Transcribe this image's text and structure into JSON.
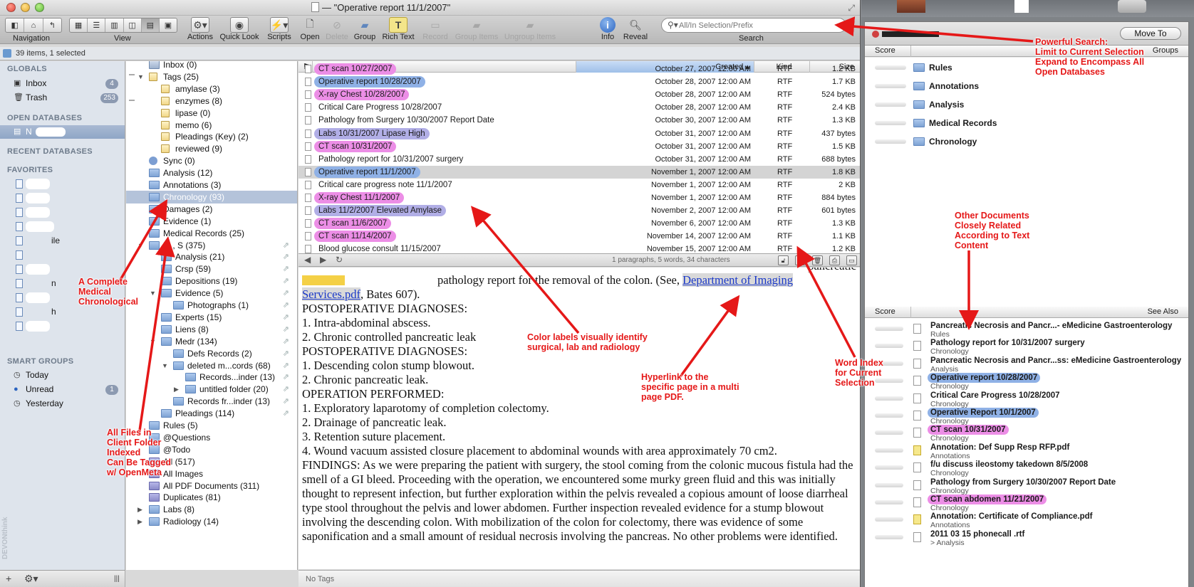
{
  "window": {
    "title": "— \"Operative report 11/1/2007\""
  },
  "toolbar": {
    "groups": {
      "navigation": "Navigation",
      "view": "View",
      "search": "Search"
    },
    "buttons": {
      "actions": "Actions",
      "quick_look": "Quick Look",
      "scripts": "Scripts",
      "open": "Open",
      "delete": "Delete",
      "group": "Group",
      "rich_text": "Rich Text",
      "record": "Record",
      "group_items": "Group Items",
      "ungroup_items": "Ungroup Items",
      "info": "Info",
      "reveal": "Reveal"
    },
    "search_placeholder": "All/In Selection/Prefix"
  },
  "status": {
    "text": "39 items, 1 selected"
  },
  "sidebar": {
    "globals_header": "GLOBALS",
    "inbox": {
      "label": "Inbox",
      "count": "4"
    },
    "trash": {
      "label": "Trash",
      "count": "253"
    },
    "open_db_header": "OPEN DATABASES",
    "open_db_item": "N",
    "recent_header": "RECENT DATABASES",
    "favorites_header": "FAVORITES",
    "favorites_text": [
      "ile",
      "n",
      "h"
    ],
    "smart_header": "SMART GROUPS",
    "today": "Today",
    "unread": {
      "label": "Unread",
      "count": "1"
    },
    "yesterday": "Yesterday",
    "vertical_brand": "DEVONthink"
  },
  "groups": [
    "Inbox (0)",
    "Tags (25)",
    "amylase (3)",
    "enzymes (8)",
    "lipase (0)",
    "memo (6)",
    "Pleadings (Key) (2)",
    "reviewed (9)",
    "Sync (0)",
    "Analysis (12)",
    "Annotations (3)",
    "Chronology (93)",
    "Damages (2)",
    "Evidence (1)",
    "Medical Records (25)",
    "M , S (375)",
    "Analysis (21)",
    "Crsp (59)",
    "Depositions (19)",
    "Evidence (5)",
    "Photographs (1)",
    "Experts (15)",
    "Liens (8)",
    "Medr (134)",
    "Defs Records (2)",
    "deleted m...cords (68)",
    "Records...inder (13)",
    "untitled folder (20)",
    "Records fr...inder (13)",
    "Pleadings (114)",
    "Rules (5)",
    "@Questions",
    "@Todo",
    "All (517)",
    "All Images",
    "All PDF Documents (311)",
    "Duplicates (81)",
    "Labs (8)",
    "Radiology (14)"
  ],
  "list": {
    "headers": {
      "name": "Name",
      "created": "Created",
      "kind": "Kind",
      "size": "Size"
    },
    "rows": [
      {
        "name": "CT scan 10/27/2007",
        "created": "October 27, 2007 12:00 AM",
        "kind": "RTF",
        "size": "1.2 KB"
      },
      {
        "name": "Operative report 10/28/2007",
        "created": "October 28, 2007 12:00 AM",
        "kind": "RTF",
        "size": "1.7 KB"
      },
      {
        "name": "X-ray Chest 10/28/2007",
        "created": "October 28, 2007 12:00 AM",
        "kind": "RTF",
        "size": "524 bytes"
      },
      {
        "name": "Critical Care Progress 10/28/2007",
        "created": "October 28, 2007 12:00 AM",
        "kind": "RTF",
        "size": "2.4 KB"
      },
      {
        "name": "Pathology from Surgery 10/30/2007 Report Date",
        "created": "October 30, 2007 12:00 AM",
        "kind": "RTF",
        "size": "1.3 KB"
      },
      {
        "name": "Labs 10/31/2007 Lipase High",
        "created": "October 31, 2007 12:00 AM",
        "kind": "RTF",
        "size": "437 bytes"
      },
      {
        "name": "CT scan 10/31/2007",
        "created": "October 31, 2007 12:00 AM",
        "kind": "RTF",
        "size": "1.5 KB"
      },
      {
        "name": "Pathology report for 10/31/2007 surgery",
        "created": "October 31, 2007 12:00 AM",
        "kind": "RTF",
        "size": "688 bytes"
      },
      {
        "name": "Operative report 11/1/2007",
        "created": "November 1, 2007 12:00 AM",
        "kind": "RTF",
        "size": "1.8 KB"
      },
      {
        "name": "Critical care progress note 11/1/2007",
        "created": "November 1, 2007 12:00 AM",
        "kind": "RTF",
        "size": "2 KB"
      },
      {
        "name": "X-ray Chest 11/1/2007",
        "created": "November 1, 2007 12:00 AM",
        "kind": "RTF",
        "size": "884 bytes"
      },
      {
        "name": "Labs 11/2/2007 Elevated Amylase",
        "created": "November 2, 2007 12:00 AM",
        "kind": "RTF",
        "size": "601 bytes"
      },
      {
        "name": "CT scan 11/6/2007",
        "created": "November 6, 2007 12:00 AM",
        "kind": "RTF",
        "size": "1.3 KB"
      },
      {
        "name": "CT scan 11/14/2007",
        "created": "November 14, 2007 12:00 AM",
        "kind": "RTF",
        "size": "1.1 KB"
      },
      {
        "name": "Blood glucose consult 11/15/2007",
        "created": "November 15, 2007 12:00 AM",
        "kind": "RTF",
        "size": "1.2 KB"
      }
    ],
    "word_count": "1 paragraphs, 5 words, 34 characters"
  },
  "doc": {
    "line0": "pancreatic",
    "line1": "pathology report for the removal of the colon. (See,",
    "link": "Department of Imaging Services.pdf",
    "after_link": ", Bates 607).",
    "lines": [
      "POSTOPERATIVE DIAGNOSES:",
      "1. Intra-abdominal abscess.",
      "2. Chronic controlled pancreatic leak",
      "POSTOPERATIVE DIAGNOSES:",
      "1. Descending colon stump blowout.",
      "2. Chronic pancreatic leak.",
      "OPERATION    PERFORMED:",
      "1. Exploratory laparotomy of completion colectomy.",
      "2. Drainage of pancreatic leak.",
      "3. Retention suture placement.",
      "4. Wound vacuum assisted closure placement to abdominal wounds with area approximately 70 cm2."
    ],
    "findings": "FINDINGS: As we were preparing the patient with surgery, the stool coming from the colonic mucous fistula had the smell of a GI bleed. Proceeding with the operation, we encountered some murky green fluid and this was initially thought to represent infection, but further exploration within the pelvis revealed a copious amount of loose diarrheal type stool throughout the pelvis and lower abdomen. Further inspection revealed evidence for a stump blowout involving the descending colon. With mobilization of the colon for colectomy, there was evidence of some saponification and a small amount of residual necrosis involving the pancreas. No other problems were identified.",
    "no_tags": "No Tags"
  },
  "see_also": {
    "move_to": "Move To",
    "score_header": "Score",
    "groups_header": "Groups",
    "see_also_header": "See Also",
    "groups": [
      "Rules",
      "Annotations",
      "Analysis",
      "Medical Records",
      "Chronology"
    ],
    "items": [
      {
        "title": "Pancreatic Necrosis and Pancr...- eMedicine Gastroenterology",
        "group": "Rules"
      },
      {
        "title": "Pathology report for 10/31/2007 surgery",
        "group": "Chronology"
      },
      {
        "title": "Pancreatic Necrosis and Pancr...ss: eMedicine Gastroenterology",
        "group": "Analysis"
      },
      {
        "title": "Operative report 10/28/2007",
        "group": "Chronology"
      },
      {
        "title": "Critical Care Progress 10/28/2007",
        "group": "Chronology"
      },
      {
        "title": "Operative Report 10/1/2007",
        "group": "Chronology"
      },
      {
        "title": "CT scan 10/31/2007",
        "group": "Chronology"
      },
      {
        "title": "Annotation: Def Supp Resp RFP.pdf",
        "group": "Annotations"
      },
      {
        "title": "f/u discuss ileostomy takedown 8/5/2008",
        "group": "Chronology"
      },
      {
        "title": "Pathology from Surgery 10/30/2007 Report Date",
        "group": "Chronology"
      },
      {
        "title": "CT scan abdomen 11/21/2007",
        "group": "Chronology"
      },
      {
        "title": "Annotation: Certificate of Compliance.pdf",
        "group": "Annotations"
      },
      {
        "title": "2011 03 15 phonecall .rtf",
        "group": "> Analysis"
      }
    ]
  },
  "annotations": {
    "search": [
      "Powerful Search:",
      "Limit to Current Selection",
      "Expand to Encompass All",
      "Open Databases"
    ],
    "chronological": [
      "A Complete",
      "Medical",
      "Chronological"
    ],
    "all_files": [
      "All Files in",
      "Client Folder",
      "Indexed",
      "Can Be Tagged",
      "w/ OpenMeta"
    ],
    "color_labels": [
      "Color labels visually identify",
      "surgical, lab and radiology"
    ],
    "hyperlink": [
      "Hyperlink to the",
      "specific page in a multi",
      "page PDF."
    ],
    "word_index": [
      "Word Index",
      "for Current",
      "Selection"
    ],
    "other_docs": [
      "Other Documents",
      "Closely Related",
      "According to Text",
      "Content"
    ]
  },
  "colors": {
    "label_blue": "#8fb1e6",
    "label_pink": "#ec8ee6",
    "label_purple": "#b1aee6",
    "annotation_red": "#e51818",
    "selection": "#b4c3da"
  }
}
